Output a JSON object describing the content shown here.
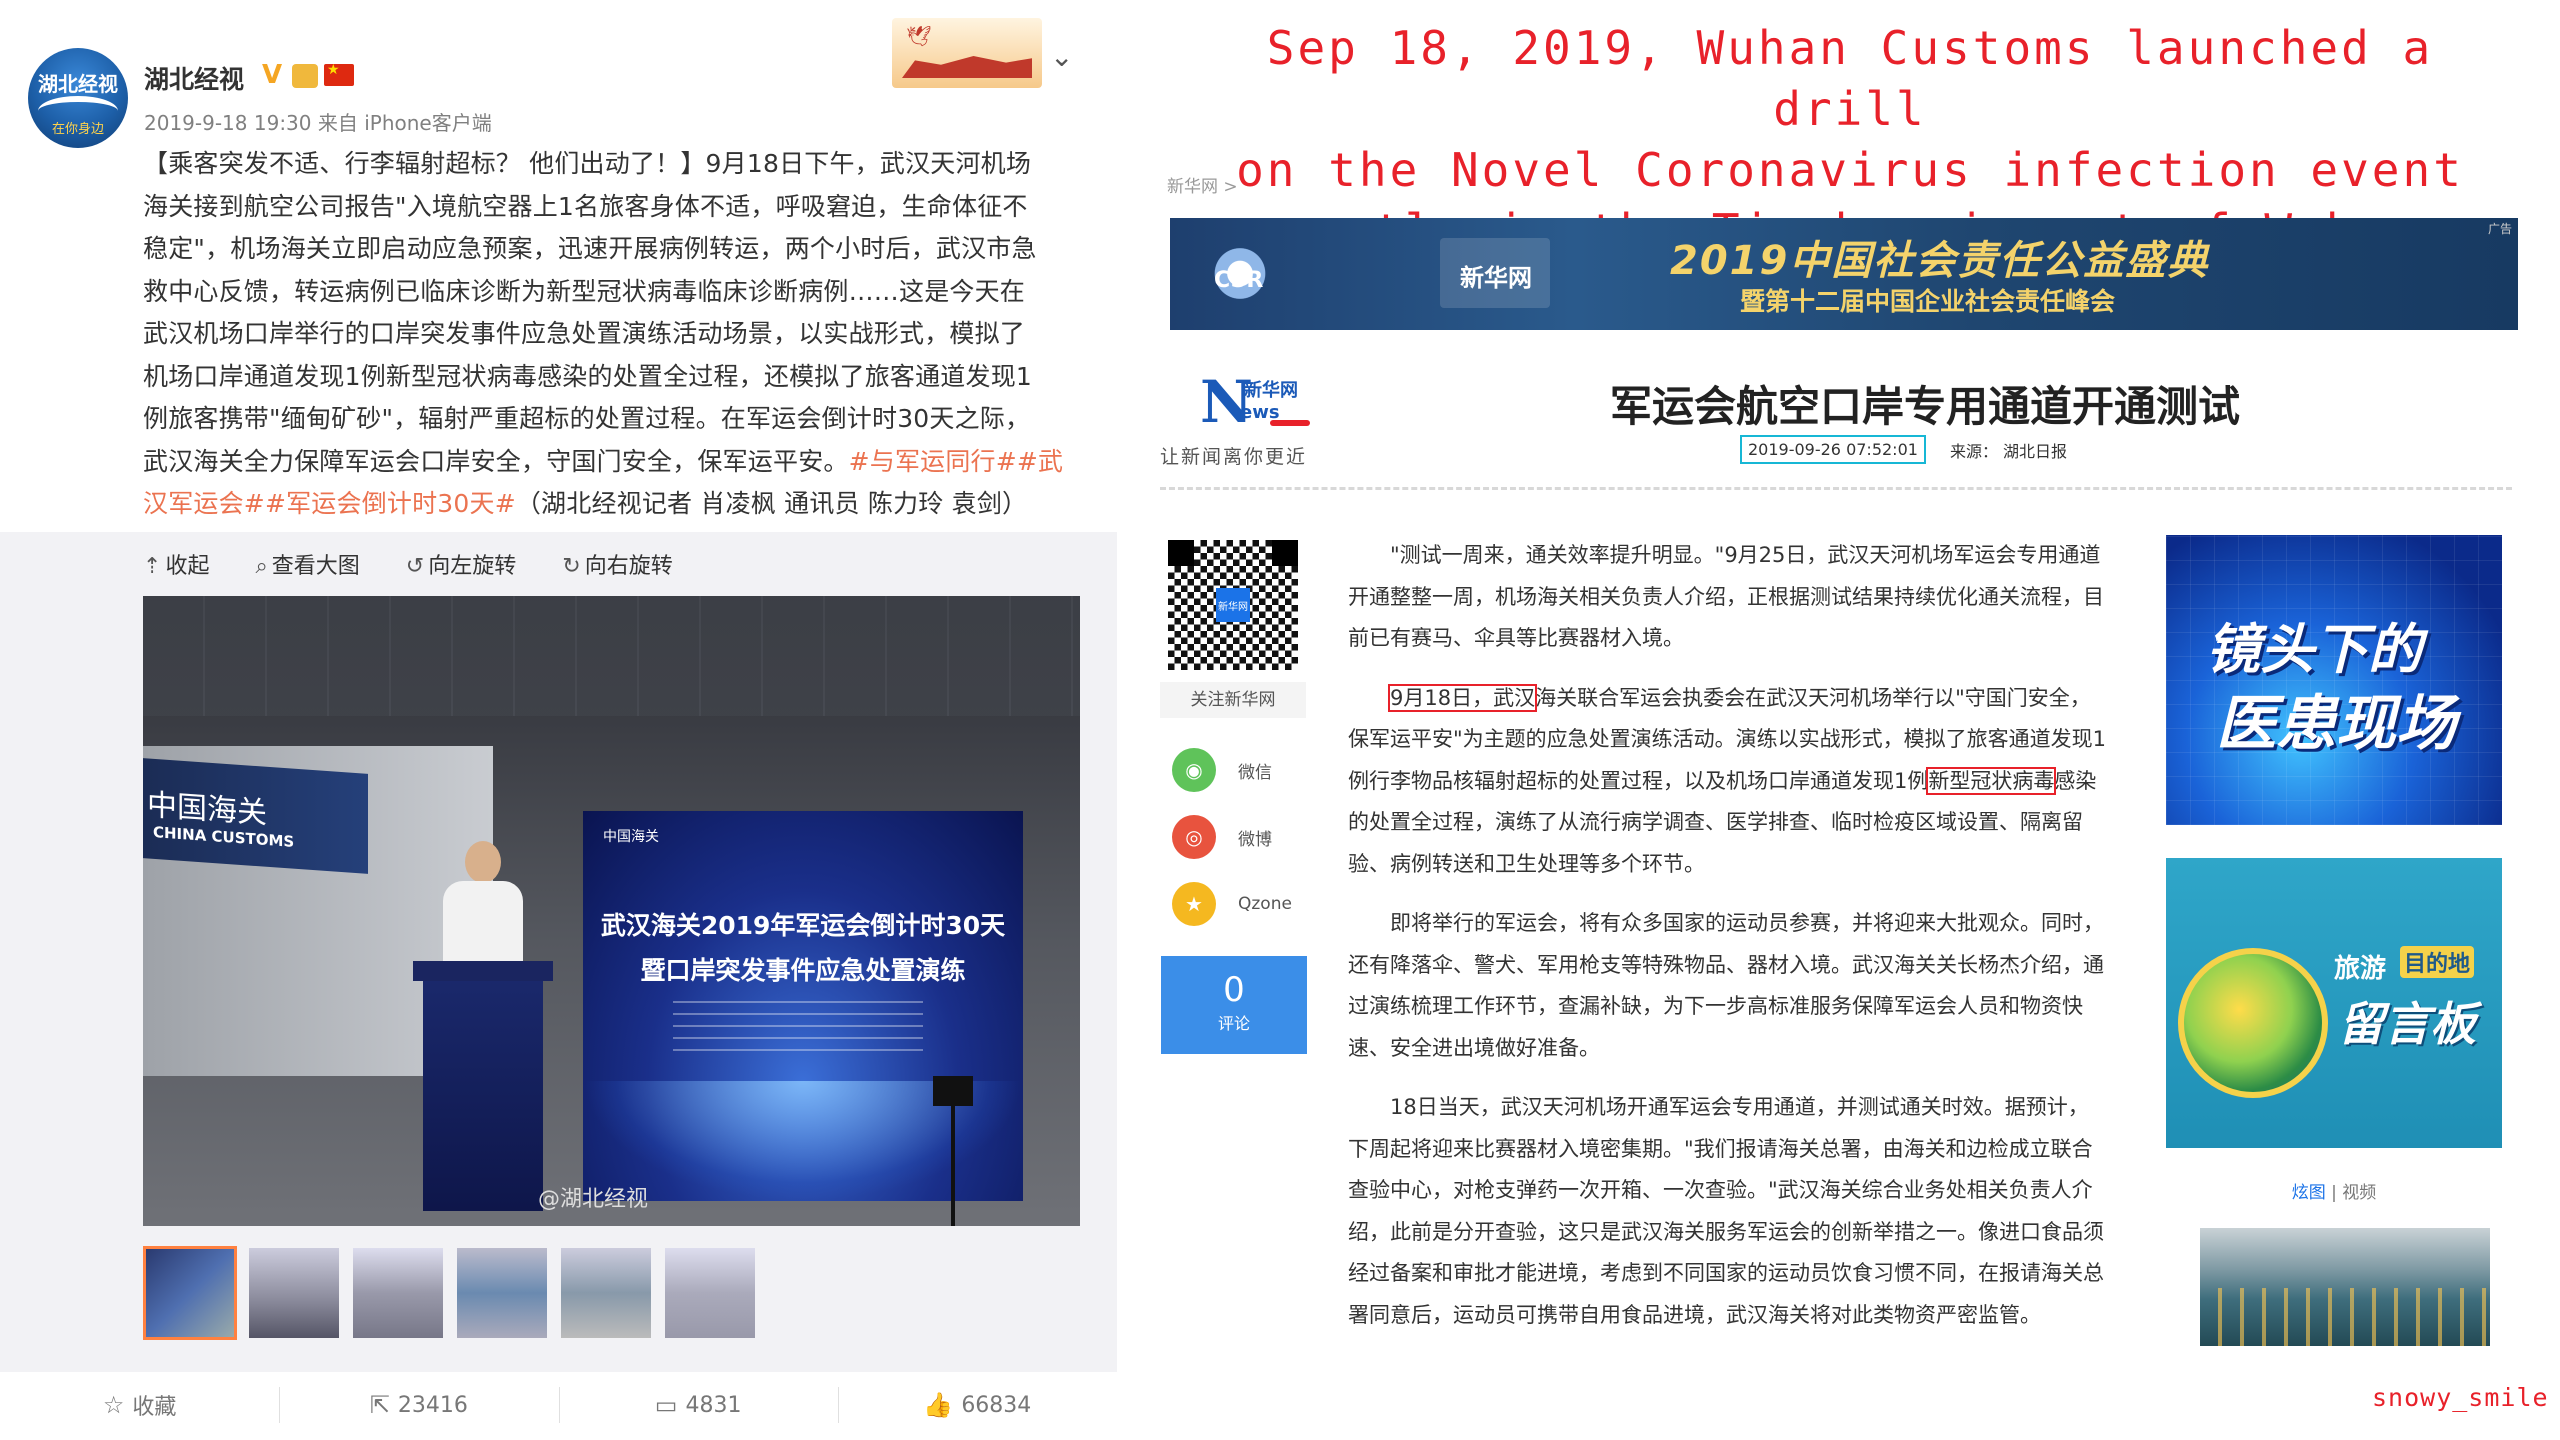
{
  "weibo": {
    "avatar_text": "湖北经视",
    "avatar_sub": "在你身边",
    "username": "湖北经视",
    "verified_badge": "V",
    "meta": "2019-9-18 19:30 来自 iPhone客户端",
    "post_lines": [
      "【乘客突发不适、行李辐射超标？ 他们出动了！】9月18日下午，武汉天河机场",
      "海关接到航空公司报告\"入境航空器上1名旅客身体不适，呼吸窘迫，生命体征不",
      "稳定\"，机场海关立即启动应急预案，迅速开展病例转运，两个小时后，武汉市急",
      "救中心反馈，转运病例已临床诊断为新型冠状病毒临床诊断病例……这是今天在",
      "武汉机场口岸举行的口岸突发事件应急处置演练活动场景，以实战形式，模拟了",
      "机场口岸通道发现1例新型冠状病毒感染的处置全过程，还模拟了旅客通道发现1",
      "例旅客携带\"缅甸矿砂\"，辐射严重超标的处置过程。在军运会倒计时30天之际，",
      "武汉海关全力保障军运会口岸安全，守国门安全，保军运平安。"
    ],
    "tags_line1": "#与军运同行##武",
    "tags_line2": "汉军运会##军运会倒计时30天#",
    "credit": "（湖北经视记者 肖凌枫 通讯员 陈力玲 袁剑）",
    "toolbar": {
      "collapse": "收起",
      "view_large": "查看大图",
      "rotate_left": "向左旋转",
      "rotate_right": "向右旋转"
    },
    "photo": {
      "sign_cn": "中国海关",
      "sign_en": "CHINA CUSTOMS",
      "screen_logo": "中国海关",
      "screen_title1": "武汉海关2019年军运会倒计时30天",
      "screen_title2": "暨口岸突发事件应急处置演练",
      "watermark": "@湖北经视"
    },
    "thumb_count": 6,
    "actions": {
      "favorite": "收藏",
      "repost": "23416",
      "comment": "4831",
      "like": "66834"
    }
  },
  "caption": {
    "line1": "Sep 18, 2019, Wuhan Customs launched a drill",
    "line2": "on the Novel Coronavirus infection event",
    "line3": "exactly in the Tianhe airport of Wuhan."
  },
  "xinhua": {
    "breadcrumb": "新华网 >",
    "ad": {
      "csr": "CSR",
      "news": "新华网",
      "title": "2019中国社会责任公益盛典",
      "subtitle": "暨第十二届中国企业社会责任峰会",
      "label": "广告"
    },
    "logo_cn": "新华网",
    "logo_n": "N",
    "logo_ews": "ews",
    "slogan": "让新闻离你更近",
    "title": "军运会航空口岸专用通道开通测试",
    "date": "2019-09-26 07:52:01",
    "source": "来源：  湖北日报",
    "qr_center": "新华网",
    "qr_follow": "关注新华网",
    "share": [
      {
        "label": "微信",
        "color": "#5fc35a",
        "glyph": "◉"
      },
      {
        "label": "微博",
        "color": "#e8533e",
        "glyph": "◎"
      },
      {
        "label": "Qzone",
        "color": "#f5b820",
        "glyph": "★"
      }
    ],
    "comments": {
      "count": "0",
      "label": "评论"
    },
    "para1": "\"测试一周来，通关效率提升明显。\"9月25日，武汉天河机场军运会专用通道开通整整一周，机场海关相关负责人介绍，正根据测试结果持续优化通关流程，目前已有赛马、伞具等比赛器材入境。",
    "para2_a": "9月18日，武汉",
    "para2_b": "海关联合军运会执委会在武汉天河机场举行以\"守国门安全，保军运平安\"为主题的应急处置演练活动。演练以实战形式，模拟了旅客通道发现1例行李物品核辐射超标的处置过程，以及机场口岸通道发现1例",
    "para2_c": "新型冠状病毒",
    "para2_d": "感染的处置全过程，演练了从流行病学调查、医学排查、临时检疫区域设置、隔离留验、病例转送和卫生处理等多个环节。",
    "para3": "即将举行的军运会，将有众多国家的运动员参赛，并将迎来大批观众。同时，还有降落伞、警犬、军用枪支等特殊物品、器材入境。武汉海关关长杨杰介绍，通过演练梳理工作环节，查漏补缺，为下一步高标准服务保障军运会人员和物资快速、安全进出境做好准备。",
    "para4": "18日当天，武汉天河机场开通军运会专用通道，并测试通关时效。据预计，下周起将迎来比赛器材入境密集期。\"我们报请海关总署，由海关和边检成立联合查验中心，对枪支弹药一次开箱、一次查验。\"武汉海关综合业务处相关负责人介绍，此前是分开查验，这只是武汉海关服务军运会的创新举措之一。像进口食品须经过备案和审批才能进境，考虑到不同国家的运动员饮食习惯不同，在报请海关总署同意后，运动员可携带自用食品进境，武汉海关将对此类物资严密监管。",
    "side_ad1": {
      "line1": "镜头下的",
      "line2": "医患现场"
    },
    "side_ad2": {
      "line1": "旅游",
      "badge": "目的地",
      "line2": "留言板"
    },
    "side_tabs": {
      "tab1": "炫图",
      "tab2": "视频"
    }
  },
  "signature": "snowy_smile"
}
